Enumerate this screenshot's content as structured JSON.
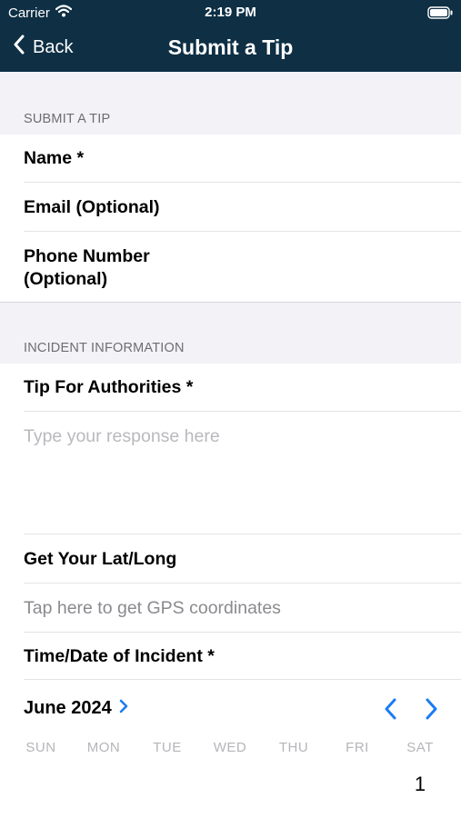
{
  "status_bar": {
    "carrier": "Carrier",
    "time": "2:19 PM"
  },
  "nav": {
    "back_label": "Back",
    "title": "Submit a Tip"
  },
  "sections": {
    "submit": "SUBMIT A TIP",
    "incident": "INCIDENT INFORMATION"
  },
  "form": {
    "name_label": "Name *",
    "email_label": "Email (Optional)",
    "phone_label_line1": "Phone Number",
    "phone_label_line2": "(Optional)",
    "tip_label": "Tip For Authorities *",
    "tip_placeholder": "Type your response here",
    "latlong_label": "Get Your Lat/Long",
    "gps_hint": "Tap here to get GPS coordinates",
    "datetime_label": "Time/Date of Incident *"
  },
  "calendar": {
    "month_label": "June 2024",
    "weekdays": [
      "SUN",
      "MON",
      "TUE",
      "WED",
      "THU",
      "FRI",
      "SAT"
    ],
    "first_day": "1"
  },
  "colors": {
    "nav_background": "#0e2f44",
    "accent": "#1b7cf2",
    "placeholder": "#b9b9be"
  }
}
